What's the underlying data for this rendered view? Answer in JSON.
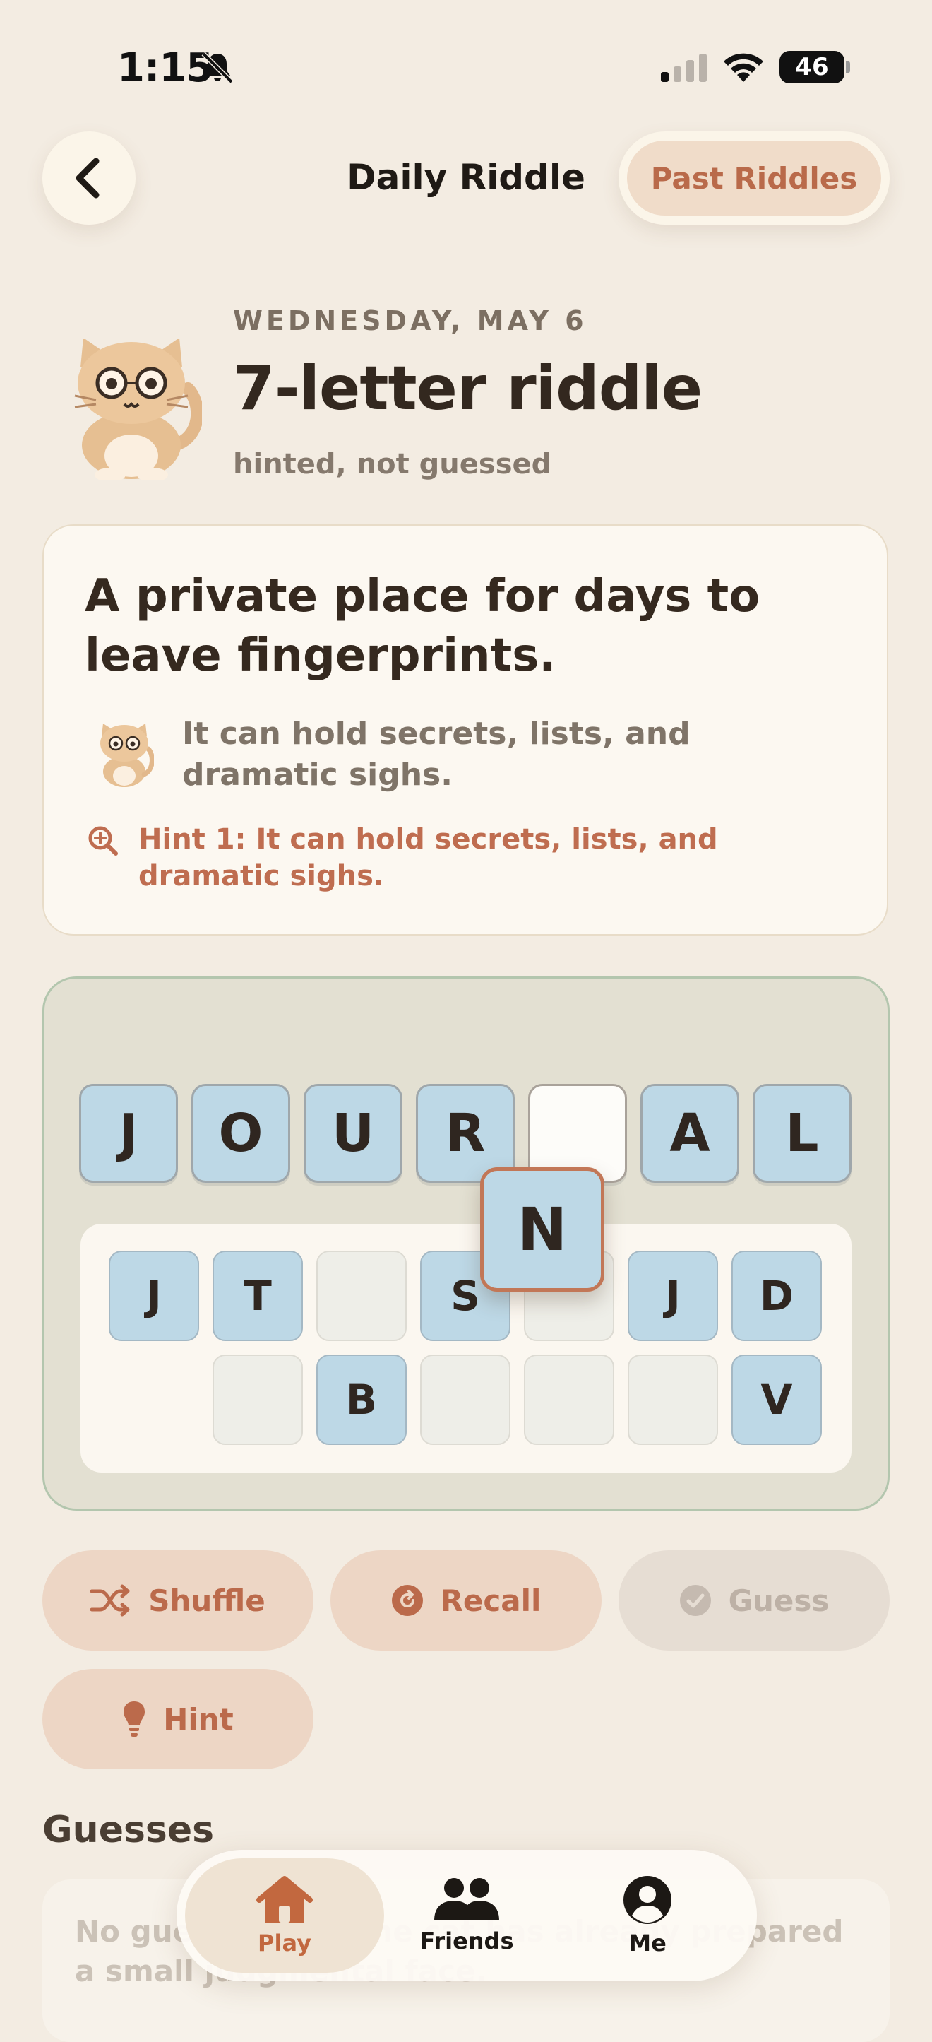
{
  "status_bar": {
    "time": "1:15",
    "battery": "46"
  },
  "header": {
    "title": "Daily Riddle",
    "past_label": "Past Riddles"
  },
  "riddle": {
    "date": "WEDNESDAY, MAY 6",
    "title": "7-letter riddle",
    "status": "hinted, not guessed",
    "clue": "A private place for days to leave fingerprints.",
    "cat_note": "It can hold secrets, lists, and dramatic sighs.",
    "hint": "Hint 1: It can hold secrets, lists, and dramatic sighs."
  },
  "board": {
    "slots": [
      "J",
      "O",
      "U",
      "R",
      "",
      "A",
      "L"
    ],
    "dragging": "N",
    "tray_row1": [
      "J",
      "T",
      "",
      "S",
      "",
      "J",
      "D"
    ],
    "tray_row2": [
      "",
      "B",
      "",
      "",
      "",
      "V"
    ]
  },
  "actions": {
    "shuffle": "Shuffle",
    "recall": "Recall",
    "guess": "Guess",
    "hint": "Hint"
  },
  "guesses": {
    "title": "Guesses",
    "empty_text": "No guesses yet. The cat has already prepared a small judgmental face."
  },
  "tabs": [
    {
      "label": "Play",
      "icon": "house-icon"
    },
    {
      "label": "Friends",
      "icon": "people-icon"
    },
    {
      "label": "Me",
      "icon": "person-circle-icon"
    }
  ],
  "colors": {
    "accent": "#c2683f",
    "tile": "#bdd8e6",
    "background": "#f3ece2"
  }
}
